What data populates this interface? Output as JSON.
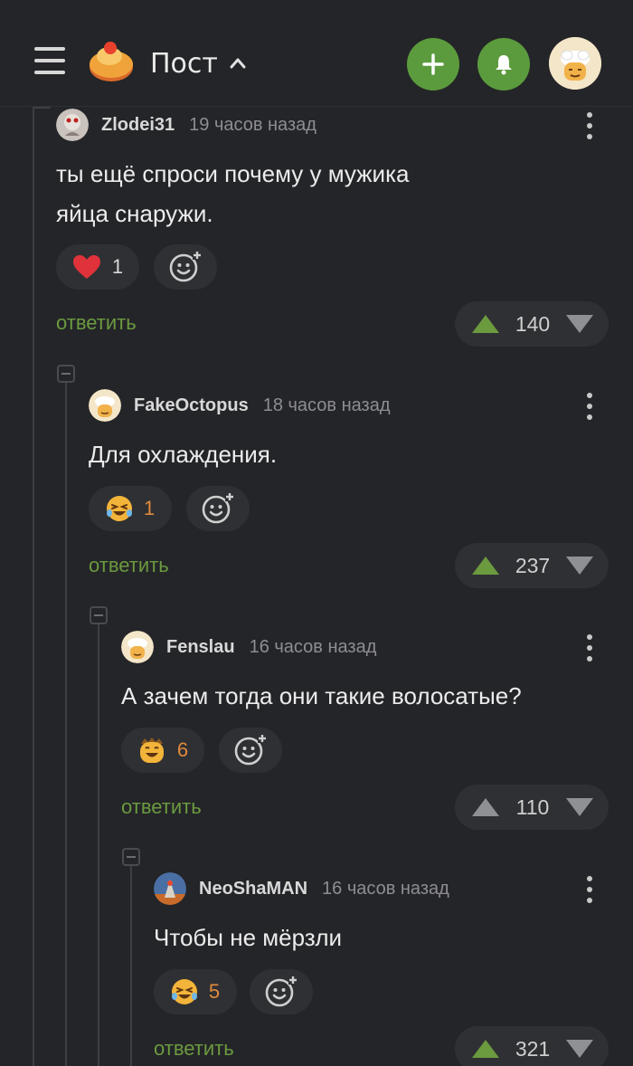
{
  "header": {
    "title": "Пост",
    "icons": [
      "menu-icon",
      "logo",
      "chevron-up-icon",
      "plus-icon",
      "bell-icon",
      "avatar"
    ],
    "accent_green": "#5b9b3d"
  },
  "comments": [
    {
      "user": "Zlodei31",
      "time": "19 часов назад",
      "text": "ты ещё спроси почему у мужика\nяйца снаружи.",
      "reaction": {
        "icon": "heart-icon",
        "count": "1"
      },
      "reply_label": "ответить",
      "score": "140",
      "up_active": true
    },
    {
      "user": "FakeOctopus",
      "time": "18 часов назад",
      "text": "Для охлаждения.",
      "reaction": {
        "icon": "laughing-emoji-icon",
        "count": "1"
      },
      "reply_label": "ответить",
      "score": "237",
      "up_active": true
    },
    {
      "user": "Fenslau",
      "time": "16 часов назад",
      "text": "А зачем тогда они такие волосатые?",
      "reaction": {
        "icon": "grinning-emoji-icon",
        "count": "6"
      },
      "reply_label": "ответить",
      "score": "110",
      "up_active": false
    },
    {
      "user": "NeoShaMAN",
      "time": "16 часов назад",
      "text": "Чтобы не мёрзли",
      "reaction": {
        "icon": "laughing-emoji-icon",
        "count": "5"
      },
      "reply_label": "ответить",
      "score": "321",
      "up_active": true
    }
  ],
  "colors": {
    "background": "#242528",
    "reply_green": "#6b9a3f",
    "vote_up_green": "#6b9a3f",
    "reaction_count_orange": "#e08a3c",
    "heart_red": "#e0323a"
  }
}
